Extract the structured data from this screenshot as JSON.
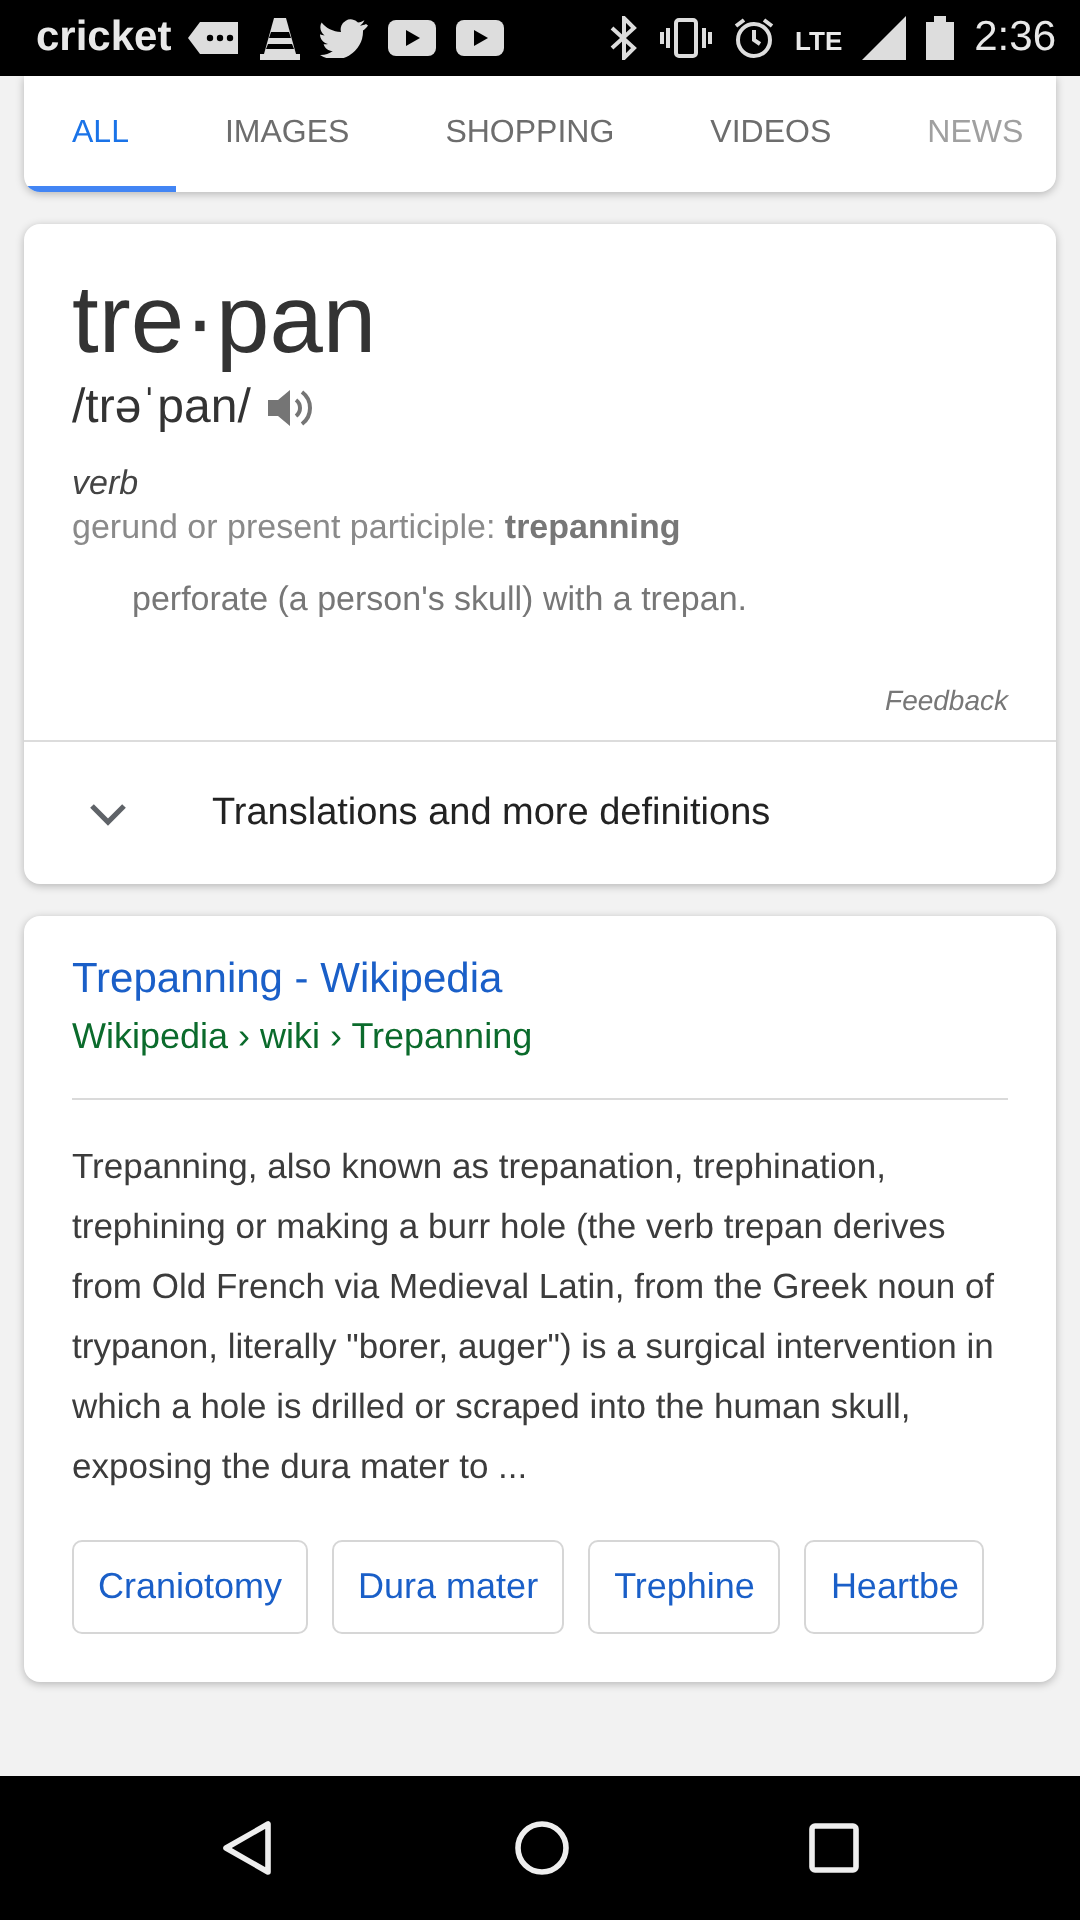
{
  "status_bar": {
    "carrier": "cricket",
    "network": "LTE",
    "time": "2:36"
  },
  "tabs": [
    {
      "label": "ALL",
      "selected": true
    },
    {
      "label": "IMAGES",
      "selected": false
    },
    {
      "label": "SHOPPING",
      "selected": false
    },
    {
      "label": "VIDEOS",
      "selected": false
    },
    {
      "label": "NEWS",
      "selected": false
    }
  ],
  "definition": {
    "word": "tre·pan",
    "pronunciation": "/trəˈpan/",
    "part_of_speech": "verb",
    "inflection": "gerund or present participle: **trepanning**",
    "meaning": "perforate (a person's skull) with a trepan.",
    "feedback": "Feedback",
    "more_link": "Translations and more definitions",
    "expanded": false
  },
  "result": {
    "title": "Trepanning - Wikipedia",
    "breadcrumb": "Wikipedia › wiki › Trepanning",
    "snippet": "Trepanning, also known as trepanation, trephination, trephining or making a burr hole (the verb trepan derives from Old French via Medieval Latin, from the Greek noun of trypanon, literally \"borer, auger\") is a surgical intervention in which a hole is drilled or scraped into the human skull, exposing the dura mater to ...",
    "chips": [
      "Craniotomy",
      "Dura mater",
      "Trephine",
      "Heartbe"
    ]
  }
}
